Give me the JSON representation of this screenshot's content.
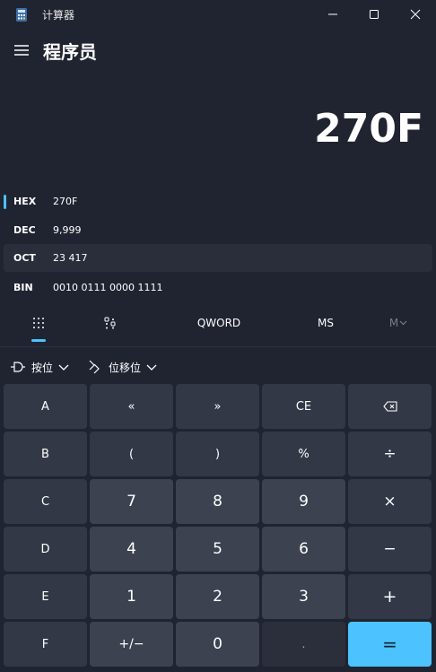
{
  "window": {
    "title": "计算器",
    "minimize_label": "—",
    "maximize_label": "□",
    "close_label": "✕"
  },
  "header": {
    "mode": "程序员",
    "menu_icon": "hamburger-menu-icon"
  },
  "display": {
    "value": "270F"
  },
  "radix": [
    {
      "label": "HEX",
      "value": "270F",
      "active": false,
      "selected": true
    },
    {
      "label": "DEC",
      "value": "9,999",
      "active": false,
      "selected": false
    },
    {
      "label": "OCT",
      "value": "23 417",
      "active": true,
      "selected": false
    },
    {
      "label": "BIN",
      "value": "0010 0111 0000 1111",
      "active": false,
      "selected": false
    }
  ],
  "tabs": {
    "keypad_icon": "full-keypad-icon",
    "bit_toggle_icon": "bit-toggle-keypad-icon",
    "word_size": "QWORD",
    "memory_store": "MS",
    "memory_menu": "M"
  },
  "bitwise": {
    "bitwise_label": "按位",
    "bitshift_label": "位移位"
  },
  "keys": {
    "r0": [
      "A",
      "«",
      "»",
      "CE",
      ""
    ],
    "r1": [
      "B",
      "(",
      ")",
      "%",
      "÷"
    ],
    "r2": [
      "C",
      "7",
      "8",
      "9",
      "×"
    ],
    "r3": [
      "D",
      "4",
      "5",
      "6",
      "−"
    ],
    "r4": [
      "E",
      "1",
      "2",
      "3",
      "+"
    ],
    "r5": [
      "F",
      "+/−",
      "0",
      ".",
      "="
    ]
  },
  "colors": {
    "background": "#202431",
    "accent": "#4cc2ff",
    "key_operator": "#333846",
    "key_number": "#3d4251"
  }
}
